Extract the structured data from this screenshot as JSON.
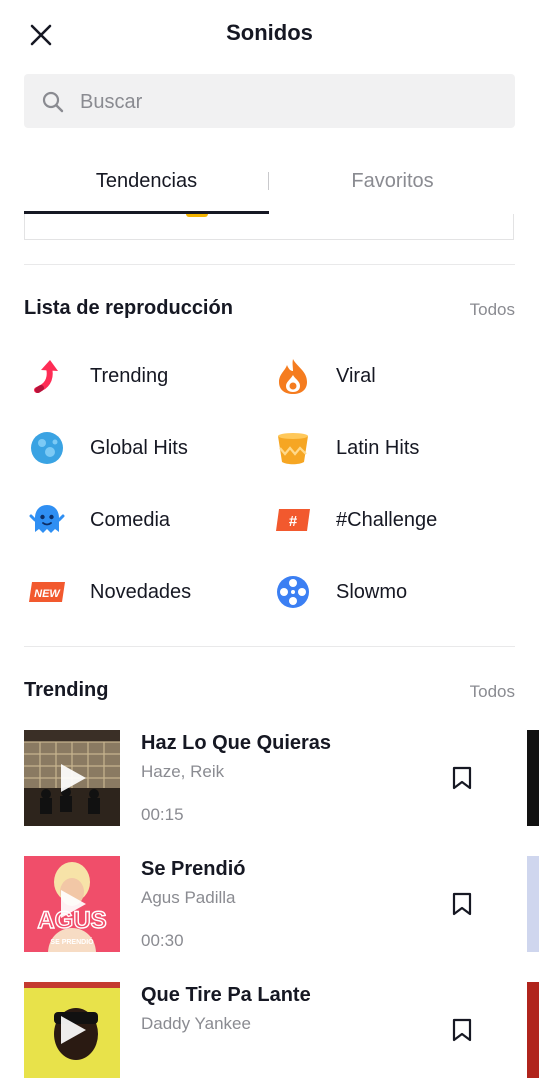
{
  "header": {
    "title": "Sonidos",
    "close_icon": "close-icon"
  },
  "search": {
    "placeholder": "Buscar",
    "value": ""
  },
  "tabs": [
    {
      "label": "Tendencias",
      "active": true
    },
    {
      "label": "Favoritos",
      "active": false
    }
  ],
  "playlists_section": {
    "title": "Lista de reproducción",
    "all_label": "Todos",
    "items": [
      {
        "label": "Trending",
        "icon": "trending-arrow-icon",
        "color": "#fe2c55"
      },
      {
        "label": "Viral",
        "icon": "flame-icon",
        "color": "#f57c1f"
      },
      {
        "label": "Global Hits",
        "icon": "globe-icon",
        "color": "#3aa3e3"
      },
      {
        "label": "Latin Hits",
        "icon": "drum-icon",
        "color": "#f6a623"
      },
      {
        "label": "Comedia",
        "icon": "ghost-icon",
        "color": "#2f8ff3"
      },
      {
        "label": "#Challenge",
        "icon": "hashtag-badge-icon",
        "color": "#f2592e"
      },
      {
        "label": "Novedades",
        "icon": "new-badge-icon",
        "color": "#f2592e",
        "badge_text": "NEW"
      },
      {
        "label": "Slowmo",
        "icon": "film-reel-icon",
        "color": "#3b7ff3"
      }
    ]
  },
  "trending_section": {
    "title": "Trending",
    "all_label": "Todos",
    "tracks": [
      {
        "title": "Haz Lo Que Quieras",
        "artist": "Haze, Reik",
        "duration": "00:15"
      },
      {
        "title": "Se Prendió",
        "artist": "Agus Padilla",
        "duration": "00:30",
        "cover_text": "AGUS",
        "cover_subtext": "SE PRENDIÓ"
      },
      {
        "title": "Que Tire Pa Lante",
        "artist": "Daddy Yankee",
        "duration": ""
      }
    ]
  },
  "colors": {
    "text_primary": "#161823",
    "text_secondary": "#8a8b91",
    "search_bg": "#f1f1f2",
    "divider": "#e9e9ea"
  }
}
